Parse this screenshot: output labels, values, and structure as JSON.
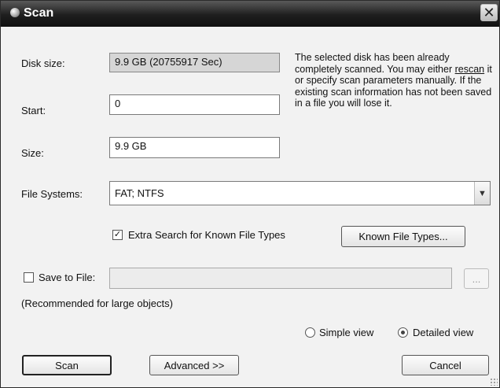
{
  "window": {
    "title": "Scan",
    "close_glyph": "✕"
  },
  "disk_size": {
    "label": "Disk size:",
    "value": "9.9 GB (20755917 Sec)"
  },
  "start": {
    "label": "Start:",
    "value": "0"
  },
  "size": {
    "label": "Size:",
    "value": "9.9 GB"
  },
  "info": {
    "text_before": "The selected disk has been already completely scanned. You may either ",
    "link": "rescan",
    "text_after": " it or specify scan parameters manually. If the existing scan information has not been saved in a file you will lose it."
  },
  "file_systems": {
    "label": "File Systems:",
    "value": "FAT; NTFS"
  },
  "extra_search": {
    "label": "Extra Search for Known File Types",
    "checked": true,
    "check_glyph": "✓"
  },
  "known_file_types_button": "Known File Types...",
  "save_to_file": {
    "label": "Save to File:",
    "checked": false,
    "value": "",
    "browse_label": "..."
  },
  "recommendation": "(Recommended for large objects)",
  "view": {
    "simple_label": "Simple view",
    "detailed_label": "Detailed view",
    "selected": "detailed"
  },
  "buttons": {
    "scan": "Scan",
    "advanced": "Advanced >>",
    "cancel": "Cancel"
  }
}
